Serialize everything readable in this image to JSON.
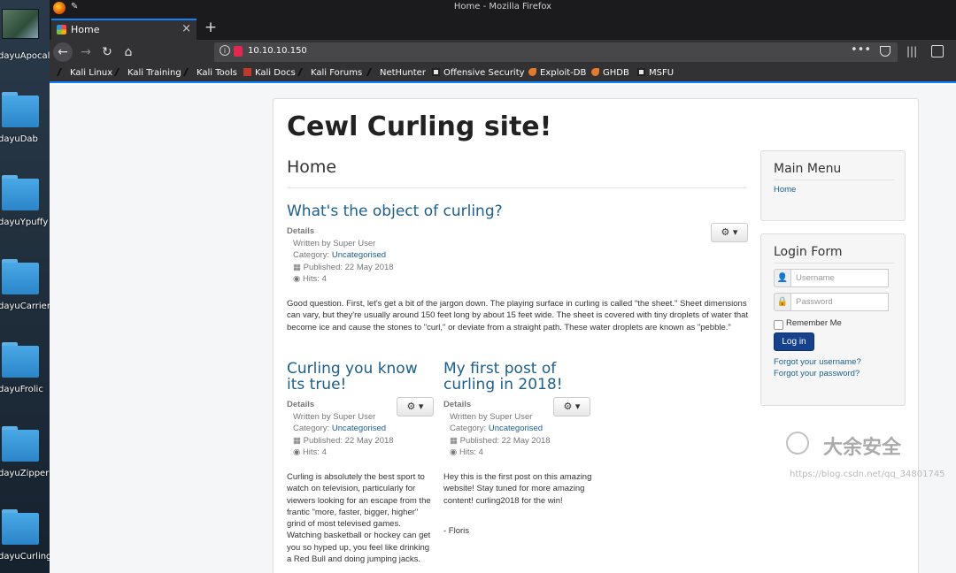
{
  "desktop": {
    "icons": [
      {
        "label": "dayuApocalyst"
      },
      {
        "label": "dayuDab"
      },
      {
        "label": "dayuYpuffy"
      },
      {
        "label": "dayuCarrier"
      },
      {
        "label": "dayuFrolic"
      },
      {
        "label": "dayuZipper"
      },
      {
        "label": "dayuCurling"
      }
    ]
  },
  "window": {
    "title": "Home - Mozilla Firefox"
  },
  "tab": {
    "label": "Home",
    "close": "×",
    "new": "+"
  },
  "nav": {
    "back": "←",
    "forward": "→",
    "reload": "↻",
    "home": "⌂",
    "url": "10.10.10.150",
    "more": "•••"
  },
  "bookmarks": [
    {
      "label": "Kali Linux",
      "icon": "kali-dragon-icon"
    },
    {
      "label": "Kali Training",
      "icon": "kali-dragon-icon"
    },
    {
      "label": "Kali Tools",
      "icon": "kali-dragon-icon"
    },
    {
      "label": "Kali Docs",
      "icon": "docs-icon"
    },
    {
      "label": "Kali Forums",
      "icon": "kali-dragon-icon"
    },
    {
      "label": "NetHunter",
      "icon": "kali-dragon-icon"
    },
    {
      "label": "Offensive Security",
      "icon": "offsec-icon"
    },
    {
      "label": "Exploit-DB",
      "icon": "exploitdb-icon"
    },
    {
      "label": "GHDB",
      "icon": "exploitdb-icon"
    },
    {
      "label": "MSFU",
      "icon": "offsec-icon"
    }
  ],
  "site": {
    "title": "Cewl Curling site!",
    "page_heading": "Home"
  },
  "articles": [
    {
      "title": "What's the object of curling?",
      "details_label": "Details",
      "author": "Written by Super User",
      "category_prefix": "Category: ",
      "category": "Uncategorised",
      "published": "Published: 22 May 2018",
      "hits": "Hits: 4",
      "body": "Good question. First, let's get a bit of the jargon down. The playing surface in curling is called \"the sheet.\" Sheet dimensions can vary, but they're usually around 150 feet long by about 15 feet wide. The sheet is covered with tiny droplets of water that become ice and cause the stones to \"curl,\" or deviate from a straight path. These water droplets are known as \"pebble.\""
    },
    {
      "title": "Curling you know its true!",
      "details_label": "Details",
      "author": "Written by Super User",
      "category_prefix": "Category: ",
      "category": "Uncategorised",
      "published": "Published: 22 May 2018",
      "hits": "Hits: 4",
      "body": "Curling is absolutely the best sport to watch on television, particularly for viewers looking for an escape from the frantic \"more, faster, bigger, higher\" grind of most televised games. Watching basketball or hockey can get you so hyped up, you feel like drinking a Red Bull and doing jumping jacks."
    },
    {
      "title": "My first post of curling in 2018!",
      "details_label": "Details",
      "author": "Written by Super User",
      "category_prefix": "Category: ",
      "category": "Uncategorised",
      "published": "Published: 22 May 2018",
      "hits": "Hits: 4",
      "body": "Hey this is the first post on this amazing website! Stay tuned for more amazing content! curling2018 for the win!",
      "signature": "- Floris"
    }
  ],
  "menu": {
    "title": "Main Menu",
    "items": [
      {
        "label": "Home"
      }
    ]
  },
  "login": {
    "title": "Login Form",
    "username_placeholder": "Username",
    "password_placeholder": "Password",
    "remember_label": "Remember Me",
    "submit_label": "Log in",
    "forgot_username": "Forgot your username?",
    "forgot_password": "Forgot your password?"
  },
  "watermark": {
    "brand": "大余安全",
    "url": "https://blog.csdn.net/qq_34801745"
  },
  "colors": {
    "link": "#1a5f8e",
    "accent": "#0a84ff",
    "button": "#16418c"
  }
}
